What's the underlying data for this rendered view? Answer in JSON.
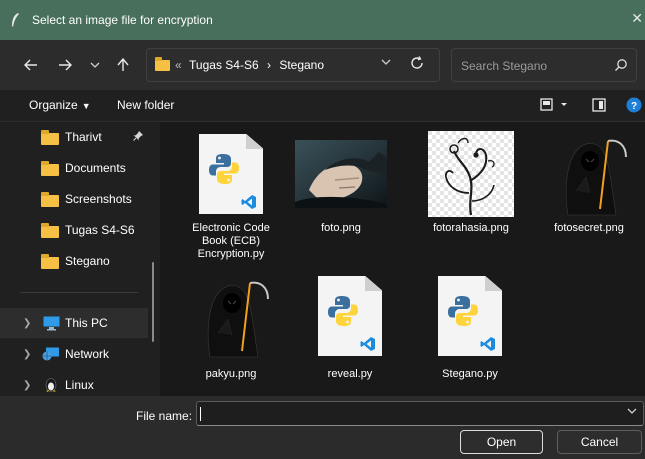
{
  "window": {
    "title": "Select an image file for encryption"
  },
  "nav": {
    "breadcrumb_overflow": "«",
    "path": [
      "Tugas S4-S6",
      "Stegano"
    ],
    "path_separator": "›",
    "search_placeholder": "Search Stegano"
  },
  "commands": {
    "organize": "Organize",
    "new_folder": "New folder"
  },
  "sidebar": {
    "quick_access": [
      {
        "label": "Tharivt",
        "pinned": true
      },
      {
        "label": "Documents"
      },
      {
        "label": "Screenshots"
      },
      {
        "label": "Tugas S4-S6"
      },
      {
        "label": "Stegano"
      }
    ],
    "locations": [
      {
        "label": "This PC",
        "selected": true
      },
      {
        "label": "Network"
      },
      {
        "label": "Linux"
      }
    ]
  },
  "files": [
    {
      "name": "Electronic Code Book (ECB) Encryption.py",
      "kind": "python"
    },
    {
      "name": "foto.png",
      "kind": "image-photo"
    },
    {
      "name": "fotorahasia.png",
      "kind": "image-floral"
    },
    {
      "name": "fotosecret.png",
      "kind": "image-reaper"
    },
    {
      "name": "pakyu.png",
      "kind": "image-reaper"
    },
    {
      "name": "reveal.py",
      "kind": "python"
    },
    {
      "name": "Stegano.py",
      "kind": "python"
    }
  ],
  "footer": {
    "file_name_label": "File name:",
    "file_name_value": "",
    "open_label": "Open",
    "cancel_label": "Cancel"
  },
  "colors": {
    "titlebar": "#476f5b",
    "folder": "#f5c044",
    "python_blue": "#3b6f9e",
    "python_yellow": "#ffd43b",
    "vscode_blue": "#1d8ce0",
    "help_blue": "#1f7fd6"
  }
}
